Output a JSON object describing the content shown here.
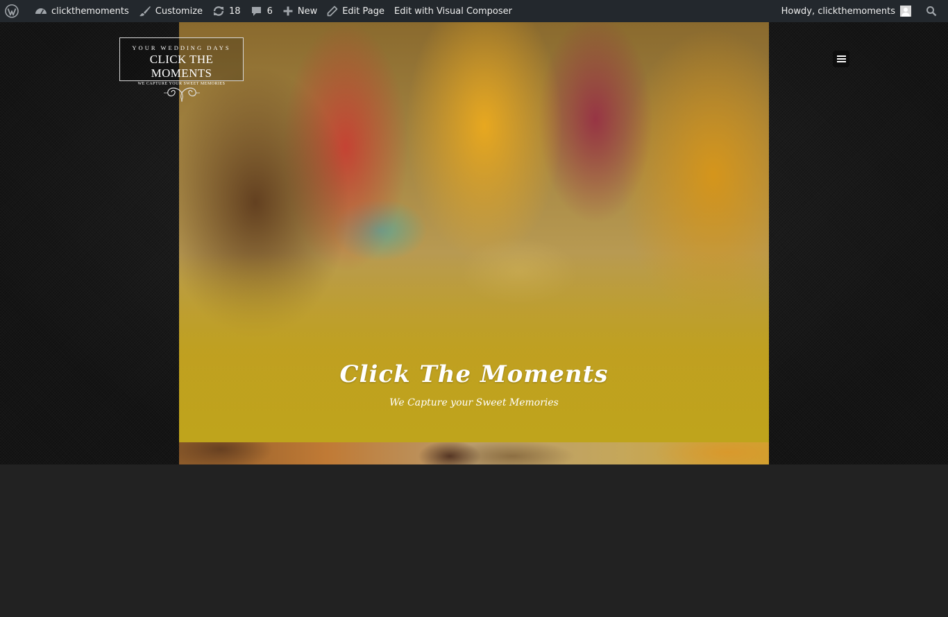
{
  "admin_bar": {
    "site_name": "clickthemoments",
    "customize_label": "Customize",
    "updates_count": "18",
    "comments_count": "6",
    "new_label": "New",
    "edit_page_label": "Edit Page",
    "visual_composer_label": "Edit with Visual Composer",
    "howdy_label": "Howdy, clickthemoments"
  },
  "logo": {
    "top_line": "YOUR WEDDING DAYS",
    "main_line": "CLICK THE MOMENTS",
    "tagline": "WE CAPTURE YOUR SWEET MEMORIES"
  },
  "hero": {
    "title": "Click  The Moments",
    "subtitle": "We Capture your Sweet Memories"
  },
  "icons": {
    "wp": "wordpress-icon",
    "dashboard": "dashboard-icon",
    "customize": "brush-icon",
    "updates": "refresh-icon",
    "comments": "comment-icon",
    "new": "plus-icon",
    "edit": "pencil-icon",
    "search": "search-icon",
    "menu": "hamburger-menu-icon"
  },
  "colors": {
    "admin_bar": "#23282d",
    "page_background": "#222222",
    "hero_gold": "#bfa41c"
  }
}
